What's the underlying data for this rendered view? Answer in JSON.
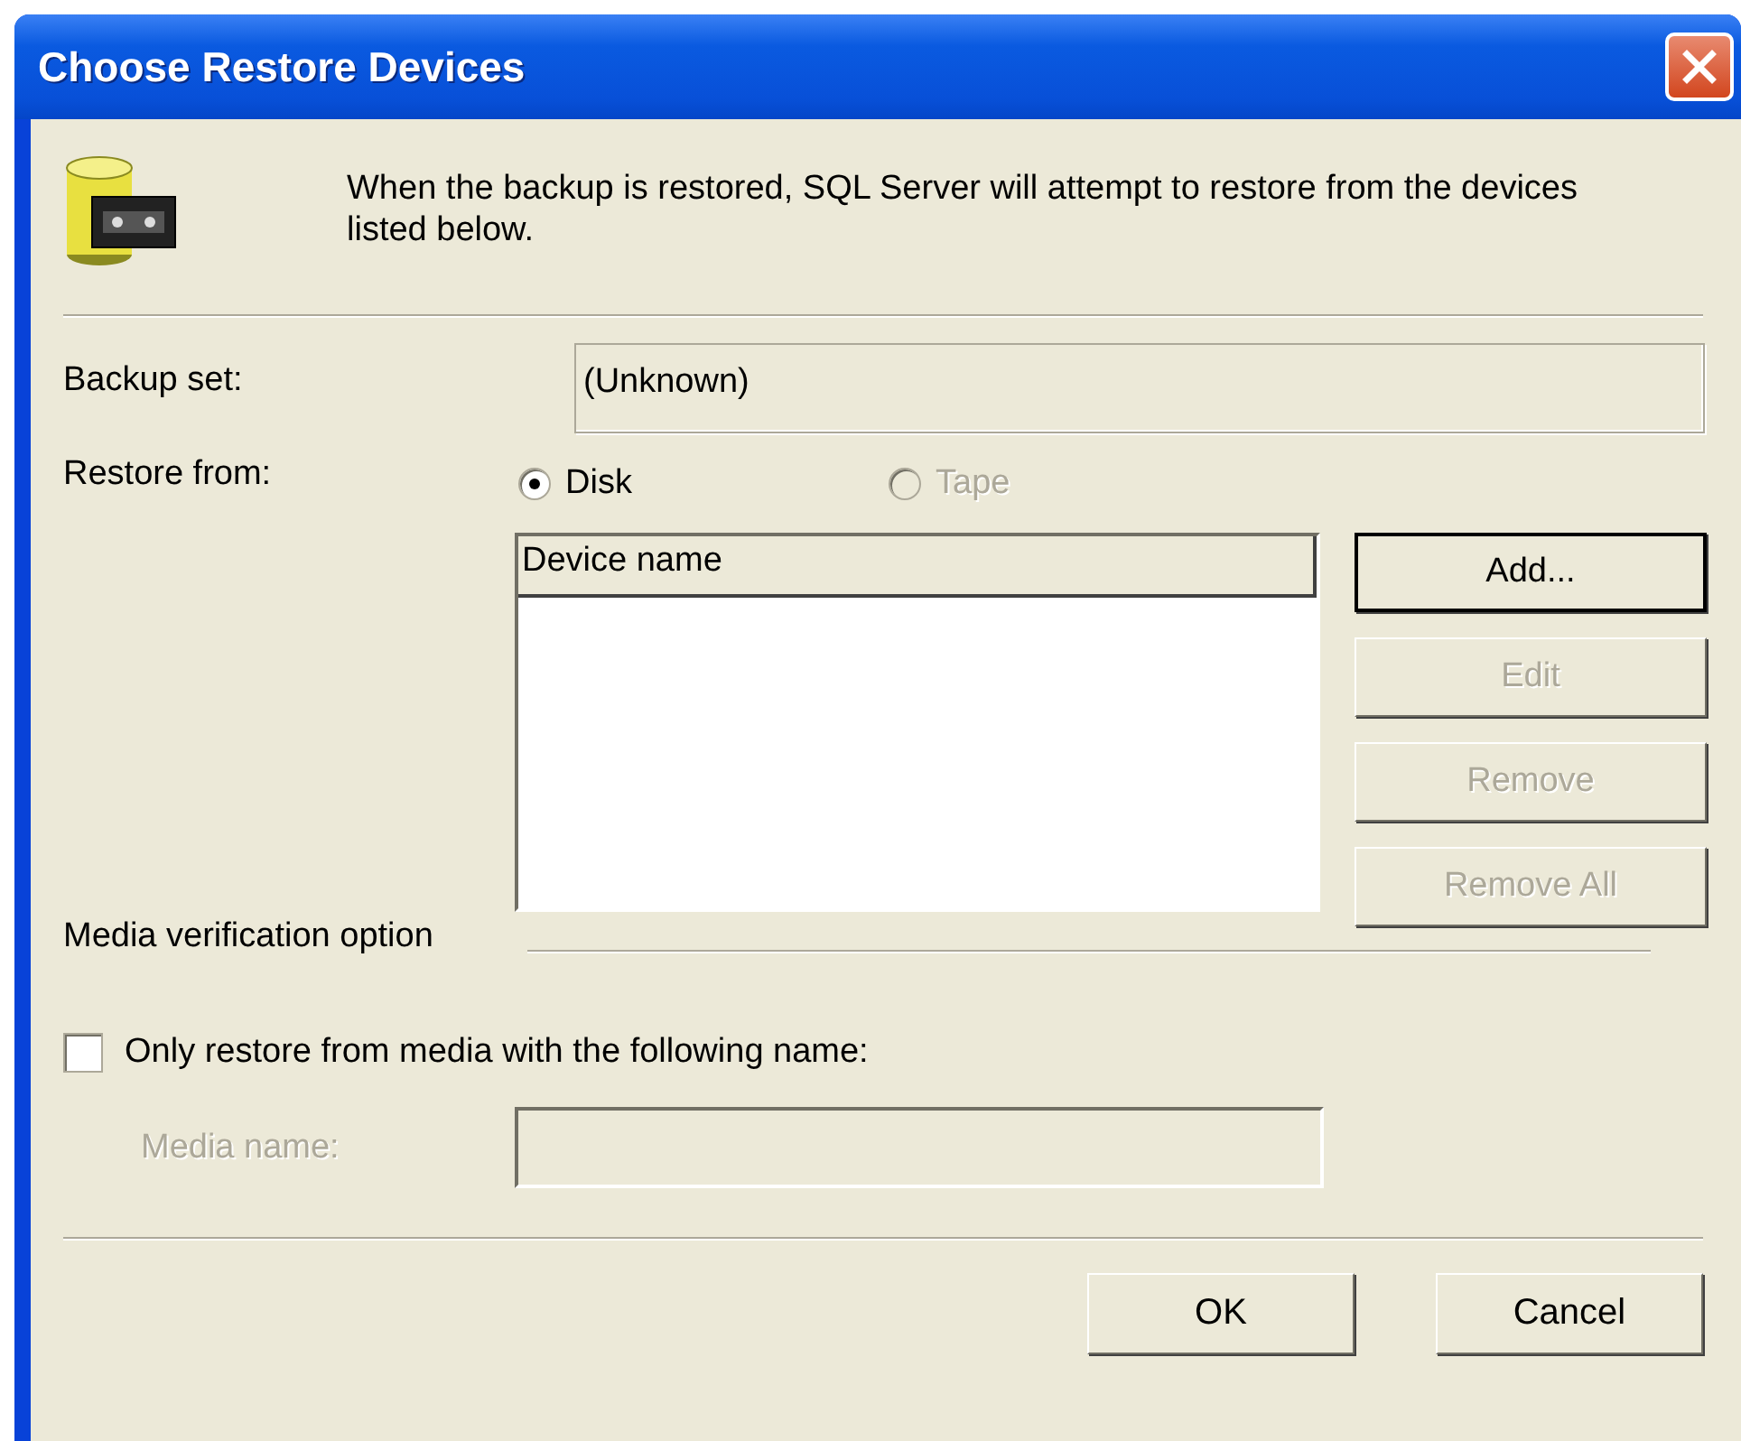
{
  "window": {
    "title": "Choose Restore Devices"
  },
  "header": {
    "message": "When the backup is restored, SQL Server will attempt to restore from the devices listed below."
  },
  "backup_set": {
    "label": "Backup set:",
    "value": "(Unknown)",
    "disabled": true
  },
  "restore_from": {
    "label": "Restore from:",
    "options": [
      {
        "label": "Disk",
        "selected": true,
        "disabled": false
      },
      {
        "label": "Tape",
        "selected": false,
        "disabled": true
      }
    ]
  },
  "device_list": {
    "columns": [
      "Device name"
    ]
  },
  "device_buttons": [
    {
      "label": "Add...",
      "disabled": false,
      "default": true
    },
    {
      "label": "Edit",
      "disabled": true,
      "default": false
    },
    {
      "label": "Remove",
      "disabled": true,
      "default": false
    },
    {
      "label": "Remove All",
      "disabled": true,
      "default": false
    }
  ],
  "media_verification": {
    "title": "Media verification option",
    "checkbox": {
      "label": "Only restore from media with the following name:",
      "checked": false
    },
    "media_name": {
      "label": "Media name:",
      "disabled": true
    }
  },
  "buttons": [
    {
      "label": "OK"
    },
    {
      "label": "Cancel"
    }
  ]
}
